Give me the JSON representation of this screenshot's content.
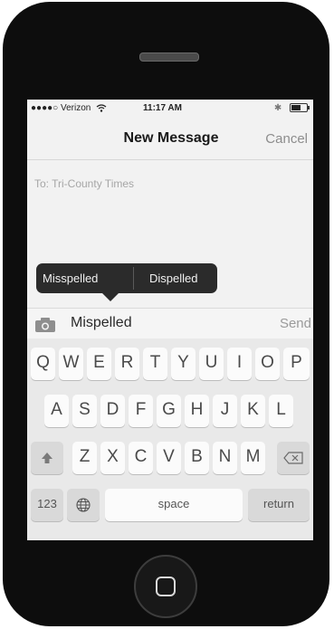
{
  "status_bar": {
    "carrier": "●●●●○ Verizon",
    "wifi_icon": "wifi-icon",
    "time": "11:17 AM",
    "bluetooth": "✱"
  },
  "nav": {
    "title": "New Message",
    "cancel": "Cancel"
  },
  "to_field": "To: Tri-County Times",
  "autocorrect": {
    "options": [
      "Misspelled",
      "Dispelled"
    ]
  },
  "message": {
    "text": "Mispelled",
    "send": "Send"
  },
  "keyboard": {
    "row1": [
      "Q",
      "W",
      "E",
      "R",
      "T",
      "Y",
      "U",
      "I",
      "O",
      "P"
    ],
    "row2": [
      "A",
      "S",
      "D",
      "F",
      "G",
      "H",
      "J",
      "K",
      "L"
    ],
    "row3": [
      "Z",
      "X",
      "C",
      "V",
      "B",
      "N",
      "M"
    ],
    "numbers": "123",
    "space": "space",
    "return": "return"
  }
}
